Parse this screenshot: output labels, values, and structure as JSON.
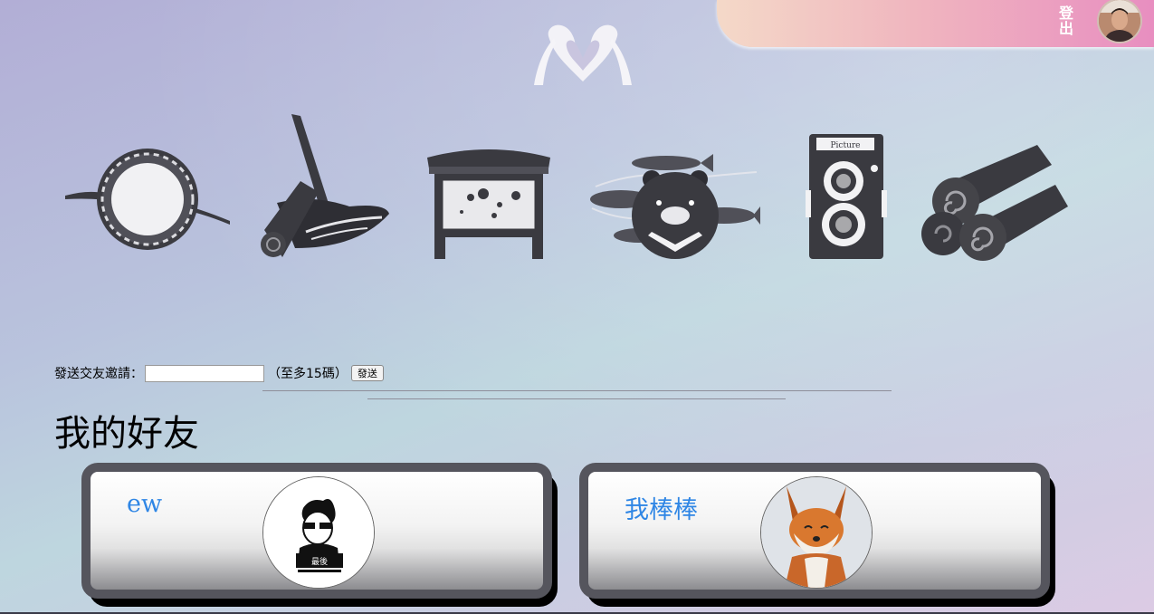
{
  "header": {
    "logout_label": "登\n出",
    "avatar_icon": "user-avatar",
    "accent_colors": [
      "#f4d9c8",
      "#f0b6bf",
      "#e88ec0"
    ]
  },
  "nav_icons": [
    {
      "name": "round-frame-icon"
    },
    {
      "name": "brush-scroll-icon"
    },
    {
      "name": "temple-board-icon"
    },
    {
      "name": "bear-fish-icon"
    },
    {
      "name": "camera-icon"
    },
    {
      "name": "scroll-rolls-icon"
    }
  ],
  "invite": {
    "label": "發送交友邀請：",
    "input_value": "",
    "hint": "（至多15碼）",
    "send_label": "發送"
  },
  "friends": {
    "title": "我的好友",
    "cards": [
      {
        "name": "ew",
        "avatar_icon": "cartoon-man-icon"
      },
      {
        "name": "我棒棒",
        "avatar_icon": "fox-photo-icon"
      }
    ]
  }
}
